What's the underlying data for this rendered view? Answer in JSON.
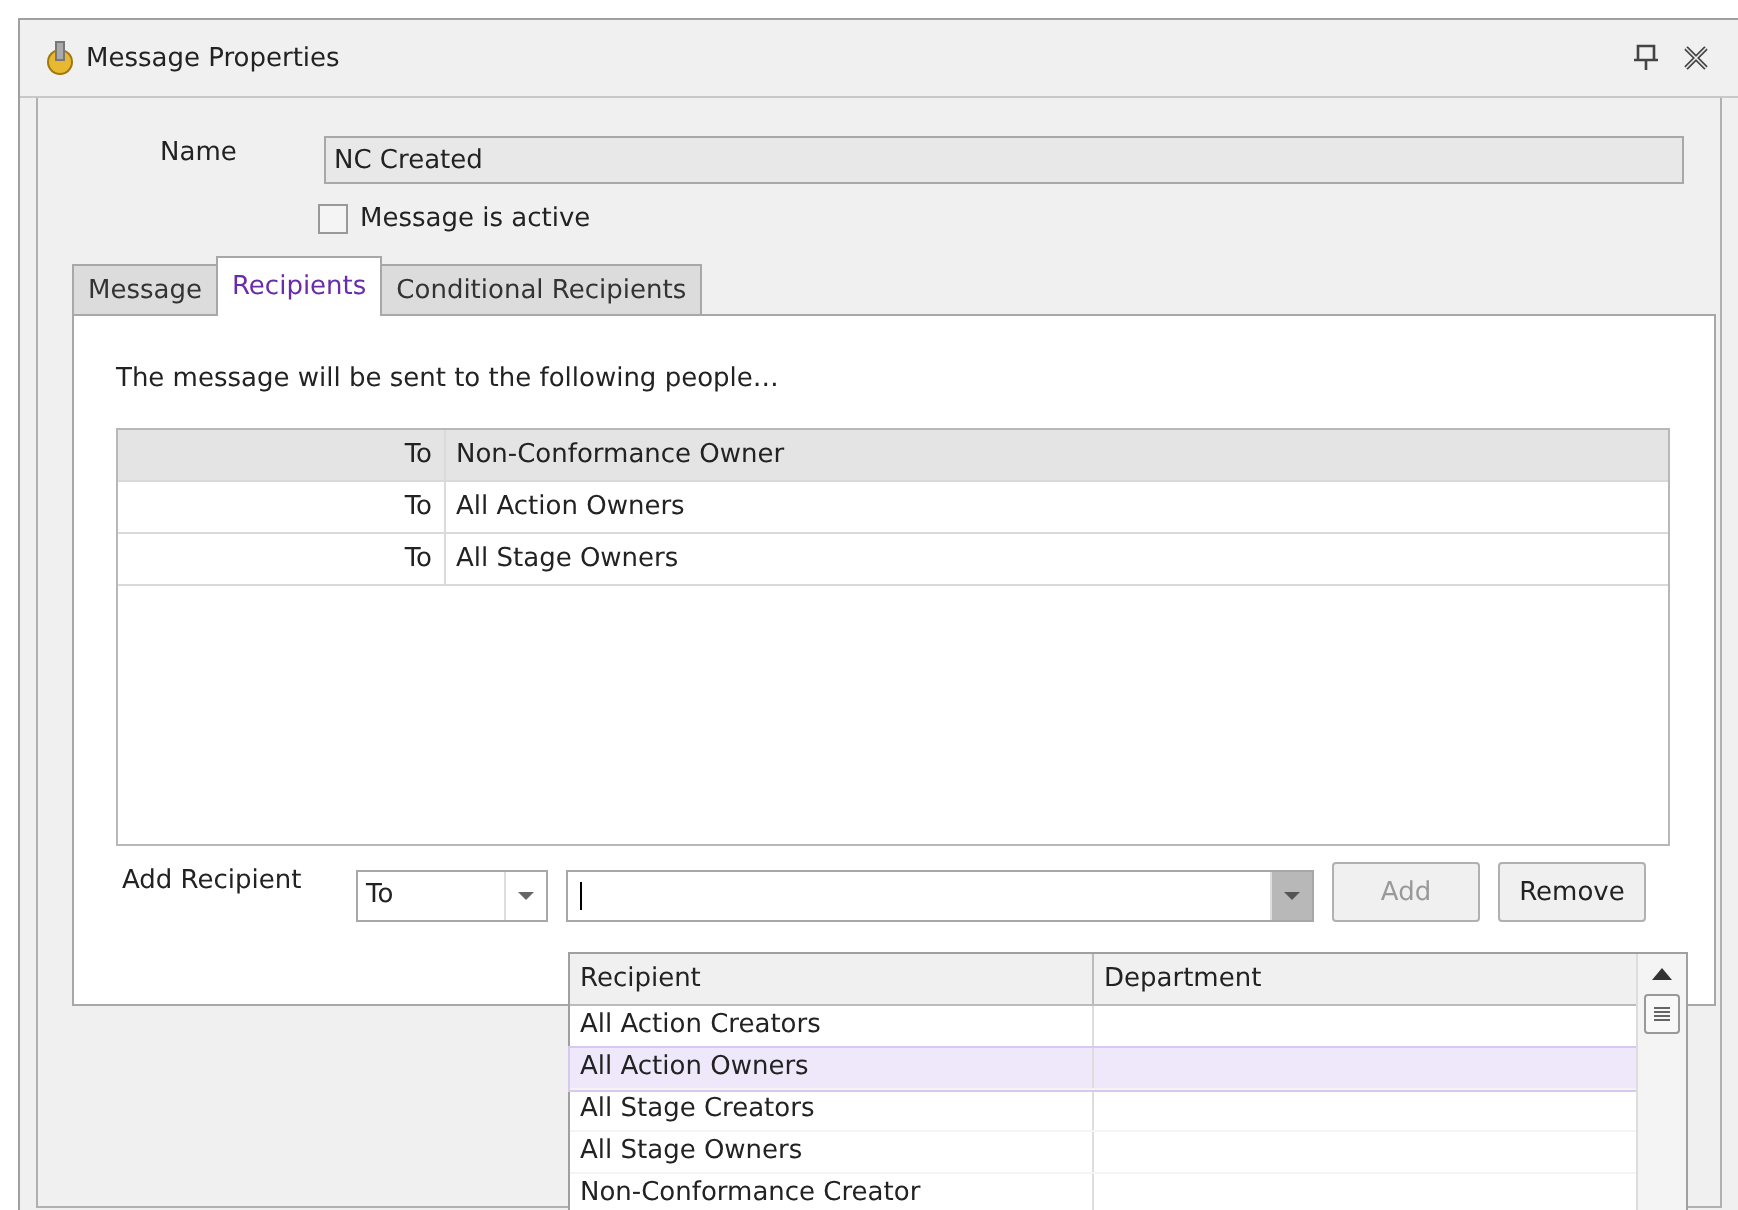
{
  "window": {
    "title": "Message Properties"
  },
  "name_field": {
    "label": "Name",
    "value": "NC Created"
  },
  "active_checkbox": {
    "label": "Message is active",
    "checked": false
  },
  "tabs": [
    {
      "label": "Message",
      "selected": false
    },
    {
      "label": "Recipients",
      "selected": true
    },
    {
      "label": "Conditional Recipients",
      "selected": false
    }
  ],
  "intro": "The message will be sent to the following people…",
  "recipients": [
    {
      "type": "To",
      "name": "Non-Conformance Owner",
      "selected": true
    },
    {
      "type": "To",
      "name": "All Action Owners",
      "selected": false
    },
    {
      "type": "To",
      "name": "All Stage Owners",
      "selected": false
    }
  ],
  "add_recipient": {
    "label": "Add Recipient",
    "type_value": "To",
    "add_button": {
      "label": "Add",
      "disabled": true
    },
    "remove_button": {
      "label": "Remove",
      "disabled": false
    }
  },
  "dropdown": {
    "columns": [
      "Recipient",
      "Department"
    ],
    "rows": [
      {
        "recipient": "All Action Creators",
        "selected": false
      },
      {
        "recipient": "All Action Owners",
        "selected": true
      },
      {
        "recipient": "All Stage Creators",
        "selected": false
      },
      {
        "recipient": "All Stage Owners",
        "selected": false
      },
      {
        "recipient": "Non-Conformance Creator",
        "selected": false
      }
    ]
  }
}
